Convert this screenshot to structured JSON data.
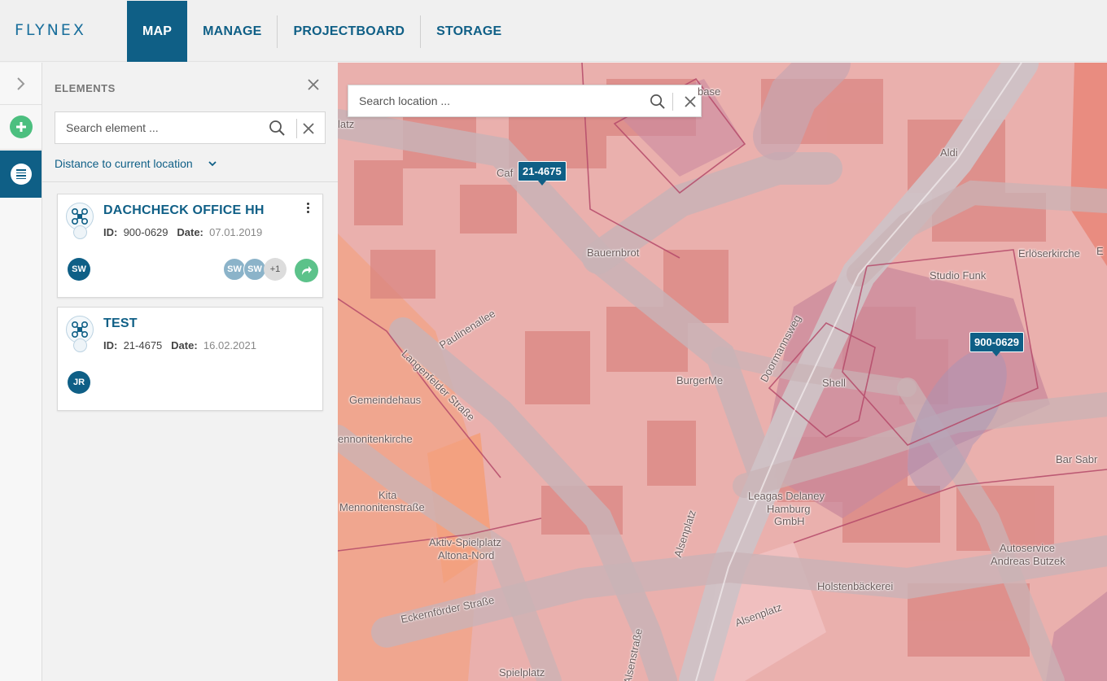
{
  "brand": {
    "logo_text": "FLYNEX"
  },
  "nav": {
    "items": [
      {
        "label": "MAP",
        "active": true
      },
      {
        "label": "MANAGE",
        "active": false
      },
      {
        "label": "PROJECTBOARD",
        "active": false
      },
      {
        "label": "STORAGE",
        "active": false
      }
    ]
  },
  "rail": {
    "expand_icon": "chevron-right-icon",
    "add_icon": "plus-icon",
    "list_icon": "list-icon"
  },
  "panel": {
    "title": "ELEMENTS",
    "search": {
      "placeholder": "Search element ...",
      "value": ""
    },
    "sort_label": "Distance to current location",
    "cards": [
      {
        "title": "DACHCHECK OFFICE HH",
        "id_label": "ID:",
        "id": "900-0629",
        "date_label": "Date:",
        "date": "07.01.2019",
        "owner": "SW",
        "shared_with": [
          "SW",
          "SW"
        ],
        "shared_more": "+1"
      },
      {
        "title": "TEST",
        "id_label": "ID:",
        "id": "21-4675",
        "date_label": "Date:",
        "date": "16.02.2021",
        "owner": "JR"
      }
    ]
  },
  "map": {
    "search": {
      "placeholder": "Search location ...",
      "value": ""
    },
    "markers": [
      "21-4675",
      "900-0629"
    ],
    "labels": {
      "base": "base",
      "platz": "latz",
      "cafe": "Caf",
      "aldi": "Aldi",
      "bauernbrot": "Bauernbrot",
      "erloeserkirche": "Erlöserkirche",
      "studio_funk": "Studio Funk",
      "paulinenallee": "Paulinenallee",
      "doormannsweg": "Doormannsweg",
      "langenfelder": "Langenfelder Straße",
      "burgerme": "BurgerMe",
      "shell": "Shell",
      "gemeindehaus": "Gemeindehaus",
      "mennonitenkirche": "ennonitenkirche",
      "bar_sabra": "Bar Sabr",
      "kita": "Kita",
      "mennonitenstrasse": "Mennonitenstraße",
      "leagas1": "Leagas Delaney",
      "leagas2": "Hamburg",
      "leagas3": "GmbH",
      "alsenplatz_v": "Alsenplatz",
      "aktiv1": "Aktiv-Spielplatz",
      "aktiv2": "Altona-Nord",
      "autoservice1": "Autoservice",
      "autoservice2": "Andreas Butzek",
      "holstenbaeckerei": "Holstenbäckerei",
      "eckernfoerder": "Eckernförder Straße",
      "alsenplatz_h": "Alsenplatz",
      "alsenstrasse": "Alsenstraße",
      "spielplatz": "Spielplatz",
      "e_edge": "E"
    }
  }
}
